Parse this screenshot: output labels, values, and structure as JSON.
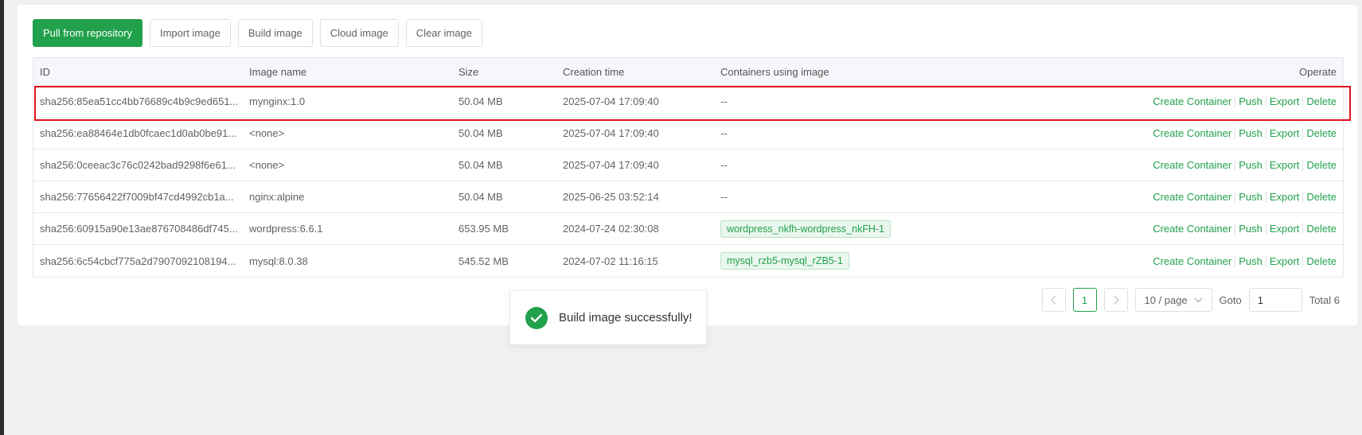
{
  "toolbar": {
    "pull": "Pull from repository",
    "import": "Import image",
    "build": "Build image",
    "cloud": "Cloud image",
    "clear": "Clear image"
  },
  "table": {
    "headers": {
      "id": "ID",
      "name": "Image name",
      "size": "Size",
      "time": "Creation time",
      "containers": "Containers using image",
      "operate": "Operate"
    },
    "actions": {
      "create": "Create Container",
      "push": "Push",
      "export": "Export",
      "delete": "Delete"
    },
    "rows": [
      {
        "id": "sha256:85ea51cc4bb76689c4b9c9ed651...",
        "name": "mynginx:1.0",
        "size": "50.04 MB",
        "time": "2025-07-04 17:09:40",
        "containers": "--"
      },
      {
        "id": "sha256:ea88464e1db0fcaec1d0ab0be91...",
        "name": "<none>",
        "size": "50.04 MB",
        "time": "2025-07-04 17:09:40",
        "containers": "--"
      },
      {
        "id": "sha256:0ceeac3c76c0242bad9298f6e61...",
        "name": "<none>",
        "size": "50.04 MB",
        "time": "2025-07-04 17:09:40",
        "containers": "--"
      },
      {
        "id": "sha256:77656422f7009bf47cd4992cb1a...",
        "name": "nginx:alpine",
        "size": "50.04 MB",
        "time": "2025-06-25 03:52:14",
        "containers": "--"
      },
      {
        "id": "sha256:60915a90e13ae876708486df745...",
        "name": "wordpress:6.6.1",
        "size": "653.95 MB",
        "time": "2024-07-24 02:30:08",
        "containers": "wordpress_nkfh-wordpress_nkFH-1"
      },
      {
        "id": "sha256:6c54cbcf775a2d7907092108194...",
        "name": "mysql:8.0.38",
        "size": "545.52 MB",
        "time": "2024-07-02 11:16:15",
        "containers": "mysql_rzb5-mysql_rZB5-1"
      }
    ]
  },
  "pagination": {
    "current_page": "1",
    "page_size": "10 / page",
    "goto_label": "Goto",
    "goto_value": "1",
    "total": "Total 6"
  },
  "toast": {
    "message": "Build image successfully!"
  },
  "colors": {
    "accent": "#21a14b",
    "highlight": "#e0121e"
  }
}
